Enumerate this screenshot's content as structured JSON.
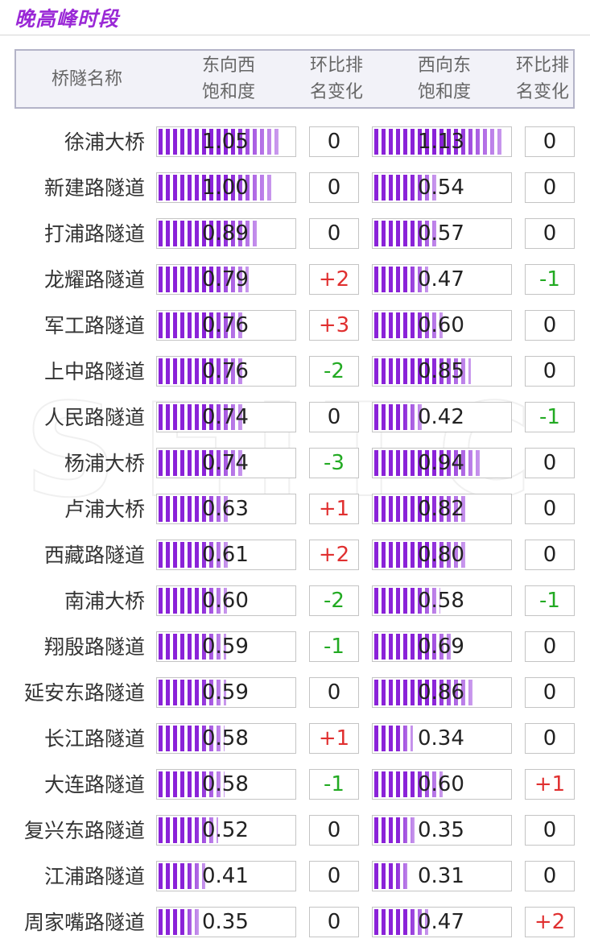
{
  "title": "晚高峰时段",
  "header": {
    "name": "桥隧名称",
    "ew": [
      "东向西",
      "饱和度"
    ],
    "ew_chg": [
      "环比排",
      "名变化"
    ],
    "we": [
      "西向东",
      "饱和度"
    ],
    "we_chg": [
      "环比排",
      "名变化"
    ]
  },
  "watermark": "SEITC",
  "bar_color": "#8a22d8",
  "increase_color": "#e03030",
  "decrease_color": "#22aa22",
  "rows": [
    {
      "name": "徐浦大桥",
      "ew": "1.05",
      "ew_chg": "0",
      "we": "1.13",
      "we_chg": "0"
    },
    {
      "name": "新建路隧道",
      "ew": "1.00",
      "ew_chg": "0",
      "we": "0.54",
      "we_chg": "0"
    },
    {
      "name": "打浦路隧道",
      "ew": "0.89",
      "ew_chg": "0",
      "we": "0.57",
      "we_chg": "0"
    },
    {
      "name": "龙耀路隧道",
      "ew": "0.79",
      "ew_chg": "+2",
      "we": "0.47",
      "we_chg": "-1"
    },
    {
      "name": "军工路隧道",
      "ew": "0.76",
      "ew_chg": "+3",
      "we": "0.60",
      "we_chg": "0"
    },
    {
      "name": "上中路隧道",
      "ew": "0.76",
      "ew_chg": "-2",
      "we": "0.85",
      "we_chg": "0"
    },
    {
      "name": "人民路隧道",
      "ew": "0.74",
      "ew_chg": "0",
      "we": "0.42",
      "we_chg": "-1"
    },
    {
      "name": "杨浦大桥",
      "ew": "0.74",
      "ew_chg": "-3",
      "we": "0.94",
      "we_chg": "0"
    },
    {
      "name": "卢浦大桥",
      "ew": "0.63",
      "ew_chg": "+1",
      "we": "0.82",
      "we_chg": "0"
    },
    {
      "name": "西藏路隧道",
      "ew": "0.61",
      "ew_chg": "+2",
      "we": "0.80",
      "we_chg": "0"
    },
    {
      "name": "南浦大桥",
      "ew": "0.60",
      "ew_chg": "-2",
      "we": "0.58",
      "we_chg": "-1"
    },
    {
      "name": "翔殷路隧道",
      "ew": "0.59",
      "ew_chg": "-1",
      "we": "0.69",
      "we_chg": "0"
    },
    {
      "name": "延安东路隧道",
      "ew": "0.59",
      "ew_chg": "0",
      "we": "0.86",
      "we_chg": "0"
    },
    {
      "name": "长江路隧道",
      "ew": "0.58",
      "ew_chg": "+1",
      "we": "0.34",
      "we_chg": "0"
    },
    {
      "name": "大连路隧道",
      "ew": "0.58",
      "ew_chg": "-1",
      "we": "0.60",
      "we_chg": "+1"
    },
    {
      "name": "复兴东路隧道",
      "ew": "0.52",
      "ew_chg": "0",
      "we": "0.35",
      "we_chg": "0"
    },
    {
      "name": "江浦路隧道",
      "ew": "0.41",
      "ew_chg": "0",
      "we": "0.31",
      "we_chg": "0"
    },
    {
      "name": "周家嘴路隧道",
      "ew": "0.35",
      "ew_chg": "0",
      "we": "0.47",
      "we_chg": "+2"
    }
  ]
}
